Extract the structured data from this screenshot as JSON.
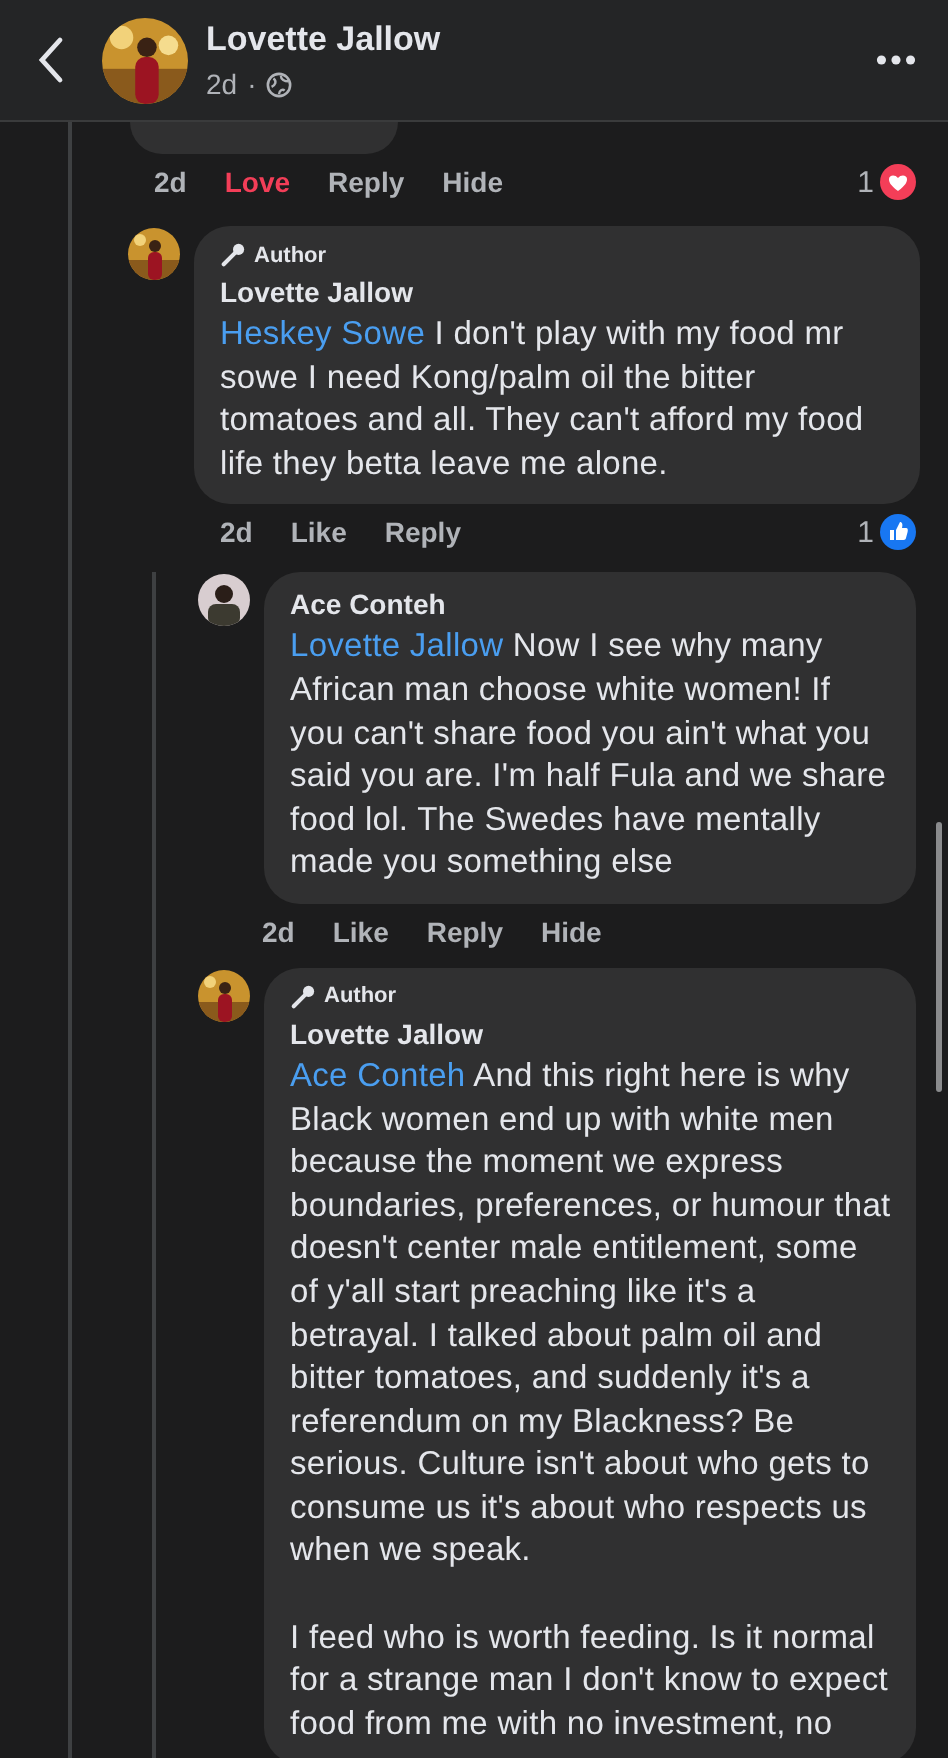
{
  "header": {
    "title": "Lovette Jallow",
    "time": "2d",
    "separator": "·"
  },
  "thread": {
    "time": "2d",
    "actions": [
      {
        "label": "Love",
        "reacted": true
      },
      {
        "label": "Reply",
        "reacted": false
      },
      {
        "label": "Hide",
        "reacted": false
      }
    ],
    "reaction": {
      "kind": "love",
      "count": "1"
    },
    "replies": [
      {
        "badge": "Author",
        "name": "Lovette Jallow",
        "mention": "Heskey Sowe",
        "paragraphs": [
          "I don't play with my food mr sowe I need Kong/palm oil the bitter tomatoes and all. They can't afford my food life they betta leave me alone."
        ],
        "time": "2d",
        "actions": [
          {
            "label": "Like",
            "reacted": false
          },
          {
            "label": "Reply",
            "reacted": false
          }
        ],
        "reaction": {
          "kind": "like",
          "count": "1"
        },
        "replies": [
          {
            "name": "Ace Conteh",
            "mention": "Lovette Jallow",
            "paragraphs": [
              "Now I see why many African man choose white women! If you can't share food you ain't what you said you are. I'm half Fula and we share food lol. The Swedes have mentally made you something else"
            ],
            "time": "2d",
            "actions": [
              {
                "label": "Like",
                "reacted": false
              },
              {
                "label": "Reply",
                "reacted": false
              },
              {
                "label": "Hide",
                "reacted": false
              }
            ]
          },
          {
            "badge": "Author",
            "name": "Lovette Jallow",
            "mention": "Ace Conteh",
            "paragraphs": [
              "And this right here is why Black women end up with white men because the moment we express boundaries, preferences, or humour that doesn't center male entitlement, some of y'all start preaching like it's a betrayal. I talked about palm oil and bitter tomatoes, and suddenly it's a referendum on my Blackness? Be serious. Culture isn't about who gets to consume us it's about who respects us when we speak.",
              "I feed who is worth feeding. Is it normal for a strange man I don't know to expect food from me with no investment, no"
            ]
          }
        ]
      }
    ]
  }
}
